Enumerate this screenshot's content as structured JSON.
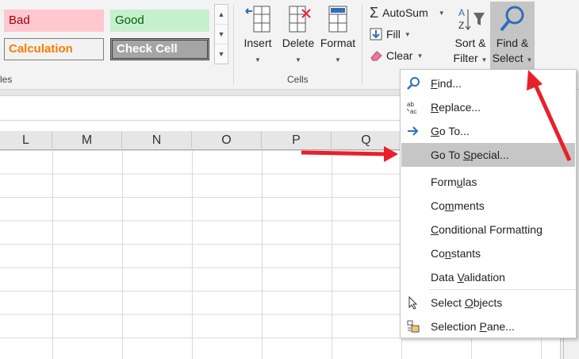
{
  "styles_gallery": {
    "bad": "Bad",
    "good": "Good",
    "calculation": "Calculation",
    "check_cell": "Check Cell",
    "group_label": "les"
  },
  "cells_group": {
    "insert": "Insert",
    "delete": "Delete",
    "format": "Format",
    "group_label": "Cells"
  },
  "editing_group": {
    "autosum": "AutoSum",
    "fill": "Fill",
    "clear": "Clear",
    "sort_filter_line1": "Sort &",
    "sort_filter_line2": "Filter",
    "find_select_line1": "Find &",
    "find_select_line2": "Select"
  },
  "columns": [
    "L",
    "M",
    "N",
    "O",
    "P",
    "Q"
  ],
  "menu": {
    "find": [
      "",
      "F",
      "ind..."
    ],
    "replace": [
      "",
      "R",
      "eplace..."
    ],
    "goto": [
      "",
      "G",
      "o To..."
    ],
    "goto_special": [
      "Go To ",
      "S",
      "pecial..."
    ],
    "formulas": [
      "Form",
      "u",
      "las"
    ],
    "comments": [
      "Co",
      "m",
      "ments"
    ],
    "conditional": [
      "",
      "C",
      "onditional Formatting"
    ],
    "constants": [
      "Co",
      "n",
      "stants"
    ],
    "data_validation": [
      "Data ",
      "V",
      "alidation"
    ],
    "select_objects": [
      "Select ",
      "O",
      "bjects"
    ],
    "selection_pane": [
      "Selection ",
      "P",
      "ane..."
    ]
  },
  "colors": {
    "accent_blue": "#2f6fb8",
    "arrow_red": "#e8202a",
    "menu_highlight": "#c6c6c6"
  }
}
